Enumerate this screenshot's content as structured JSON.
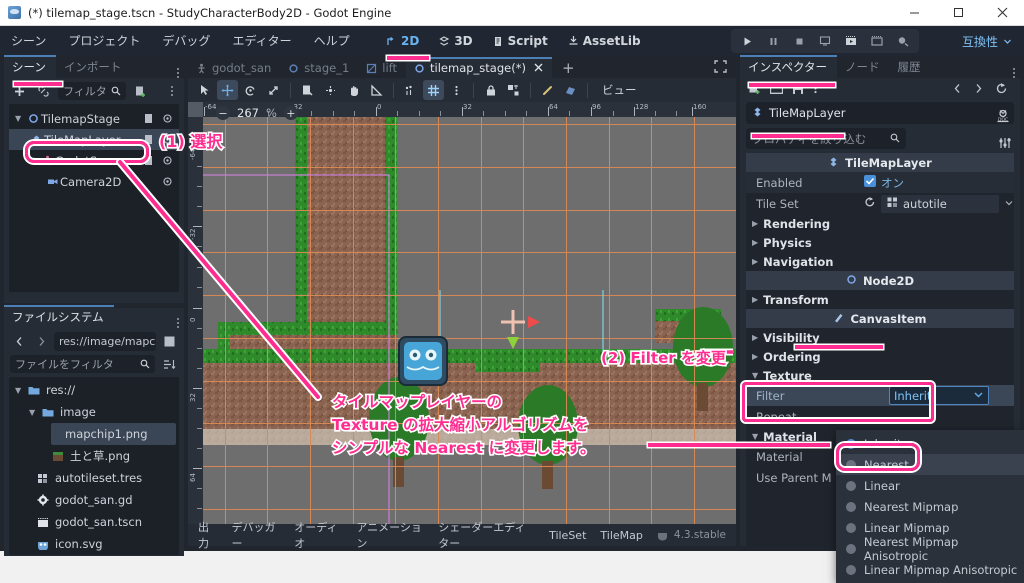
{
  "window": {
    "title": "(*) tilemap_stage.tscn - StudyCharacterBody2D - Godot Engine",
    "minimize_label": "—",
    "maximize_label": "□",
    "close_label": "✕"
  },
  "menubar": {
    "items": [
      "シーン",
      "プロジェクト",
      "デバッグ",
      "エディター",
      "ヘルプ"
    ],
    "mode_tabs": [
      {
        "label": "2D",
        "active": true
      },
      {
        "label": "3D",
        "active": false
      },
      {
        "label": "Script",
        "active": false
      },
      {
        "label": "AssetLib",
        "active": false
      }
    ],
    "renderer": "互換性"
  },
  "left_dock": {
    "tabs": [
      {
        "label": "シーン",
        "active": true
      },
      {
        "label": "インポート",
        "active": false
      }
    ],
    "filter_placeholder": "フィルタ",
    "tree": [
      {
        "label": "TilemapStage",
        "icon": "node2d-icon",
        "depth": 0,
        "selected": false
      },
      {
        "label": "TileMapLayer",
        "icon": "tilemaplayer-icon",
        "depth": 1,
        "selected": true
      },
      {
        "label": "GodotSan",
        "icon": "characterbody2d-icon",
        "depth": 1,
        "selected": false
      },
      {
        "label": "Camera2D",
        "icon": "camera2d-icon",
        "depth": 2,
        "selected": false
      }
    ]
  },
  "filesystem": {
    "tab_label": "ファイルシステム",
    "path_value": "res://image/mapchi",
    "filter_placeholder": "ファイルをフィルタ",
    "files": [
      {
        "label": "res://",
        "icon": "folder-icon",
        "depth": 0,
        "selected": false
      },
      {
        "label": "image",
        "icon": "folder-icon",
        "depth": 1,
        "selected": false
      },
      {
        "label": "mapchip1.png",
        "icon": "image-icon",
        "depth": 2,
        "selected": true
      },
      {
        "label": "土と草.png",
        "icon": "image-icon",
        "depth": 2,
        "selected": false
      },
      {
        "label": "autotileset.tres",
        "icon": "tileset-icon",
        "depth": 1,
        "selected": false
      },
      {
        "label": "godot_san.gd",
        "icon": "script-icon",
        "depth": 1,
        "selected": false
      },
      {
        "label": "godot_san.tscn",
        "icon": "scene-icon",
        "depth": 1,
        "selected": false
      },
      {
        "label": "icon.svg",
        "icon": "godot-icon",
        "depth": 1,
        "selected": false
      }
    ]
  },
  "center": {
    "scene_tabs": [
      {
        "label": "godot_san",
        "icon": "characterbody2d-icon",
        "active": false,
        "closable": false
      },
      {
        "label": "stage_1",
        "icon": "node2d-icon",
        "active": false,
        "closable": false
      },
      {
        "label": "lift",
        "icon": "animatable-icon",
        "active": false,
        "closable": false
      },
      {
        "label": "tilemap_stage(*)",
        "icon": "node2d-icon",
        "active": true,
        "closable": true
      }
    ],
    "add_tab_label": "+",
    "tools": [
      {
        "name": "select-tool",
        "active": false
      },
      {
        "name": "move-tool",
        "active": true
      },
      {
        "name": "rotate-tool",
        "active": false
      },
      {
        "name": "scale-tool",
        "active": false
      },
      {
        "name": "list-select-tool",
        "active": false
      },
      {
        "name": "pivot-tool",
        "active": false
      },
      {
        "name": "pan-tool",
        "active": false
      },
      {
        "name": "ruler-tool",
        "active": false
      },
      {
        "name": "snap-tool",
        "active": false
      },
      {
        "name": "grid-snap-tool",
        "active": true
      },
      {
        "name": "snap-options-tool",
        "active": false
      },
      {
        "name": "lock-tool",
        "active": false
      },
      {
        "name": "group-tool",
        "active": false
      },
      {
        "name": "skeleton-tool",
        "active": false
      },
      {
        "name": "bone-tool",
        "active": false
      }
    ],
    "view_button": "ビュー",
    "zoom_value": "267",
    "zoom_unit": "%",
    "zoom_out": "−",
    "zoom_in": "+",
    "ruler_h_ticks": [
      "-64",
      "-32",
      "0",
      "32",
      "64",
      "96",
      "128",
      "160"
    ],
    "ruler_v_ticks": [
      "-64",
      "-32",
      "0",
      "32",
      "64"
    ]
  },
  "bottom_panel": {
    "items": [
      "出力",
      "デバッガー",
      "オーディオ",
      "アニメーション",
      "シェーダーエディター",
      "TileSet",
      "TileMap"
    ],
    "version": "4.3.stable"
  },
  "inspector": {
    "tabs": [
      {
        "label": "インスペクター",
        "active": true
      },
      {
        "label": "ノード",
        "active": false
      },
      {
        "label": "履歴",
        "active": false
      }
    ],
    "node_name": "TileMapLayer",
    "property_filter_placeholder": "プロパティを絞り込む",
    "rows": [
      {
        "type": "category",
        "label": "TileMapLayer",
        "icon": "tilemaplayer-icon"
      },
      {
        "type": "prop",
        "label": "Enabled",
        "value": "オン",
        "control": "checkbox",
        "checked": true
      },
      {
        "type": "prop",
        "label": "Tile Set",
        "value": "autotile",
        "control": "resource"
      },
      {
        "type": "group",
        "label": "Rendering",
        "expanded": false
      },
      {
        "type": "group",
        "label": "Physics",
        "expanded": false
      },
      {
        "type": "group",
        "label": "Navigation",
        "expanded": false
      },
      {
        "type": "category",
        "label": "Node2D",
        "icon": "node2d-icon"
      },
      {
        "type": "group",
        "label": "Transform",
        "expanded": false
      },
      {
        "type": "category",
        "label": "CanvasItem",
        "icon": "canvasitem-icon"
      },
      {
        "type": "group",
        "label": "Visibility",
        "expanded": false
      },
      {
        "type": "group",
        "label": "Ordering",
        "expanded": false
      },
      {
        "type": "group",
        "label": "Texture",
        "expanded": true
      },
      {
        "type": "prop",
        "label": "Filter",
        "value": "Inherit",
        "control": "combo",
        "highlighted": true
      },
      {
        "type": "prop",
        "label": "Repeat",
        "value": "",
        "control": "combo"
      },
      {
        "type": "group",
        "label": "Material",
        "expanded": true
      },
      {
        "type": "prop",
        "label": "Material",
        "value": "",
        "control": "resource"
      },
      {
        "type": "prop",
        "label": "Use Parent M",
        "value": "",
        "control": "checkbox"
      }
    ]
  },
  "filter_dropdown": {
    "options": [
      {
        "label": "Inherit",
        "selected": true,
        "highlighted": false
      },
      {
        "label": "Nearest",
        "selected": false,
        "highlighted": true
      },
      {
        "label": "Linear",
        "selected": false,
        "highlighted": false
      },
      {
        "label": "Nearest Mipmap",
        "selected": false,
        "highlighted": false
      },
      {
        "label": "Linear Mipmap",
        "selected": false,
        "highlighted": false
      },
      {
        "label": "Nearest Mipmap Anisotropic",
        "selected": false,
        "highlighted": false
      },
      {
        "label": "Linear Mipmap Anisotropic",
        "selected": false,
        "highlighted": false
      }
    ]
  },
  "annotations": {
    "step1": "(1) 選択",
    "step2": "(2) Filter を変更",
    "description_line1": "タイルマップレイヤーの",
    "description_line2": "Texture の拡大縮小アルゴリズムを",
    "description_line3": "シンプルな Nearest に変更します。",
    "accent_color": "#ff2d8f"
  }
}
